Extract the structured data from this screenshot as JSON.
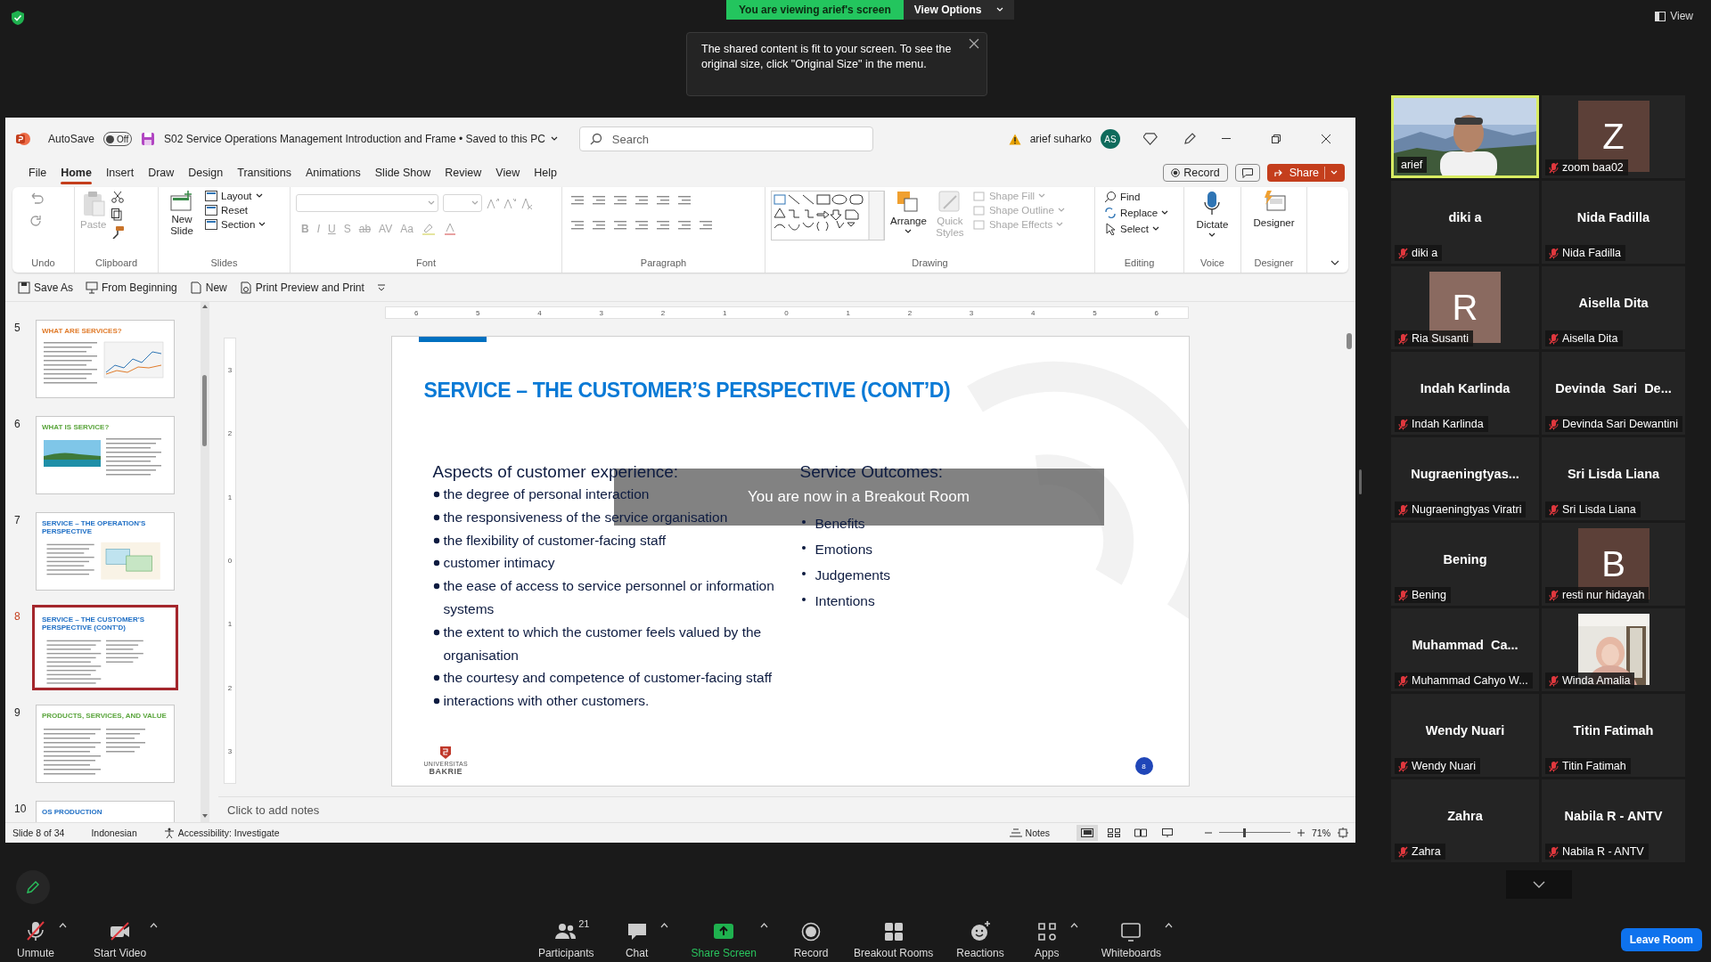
{
  "meeting": {
    "viewing_banner": "You are viewing arief's screen",
    "view_options": "View Options",
    "view_button": "View",
    "notice": "The shared content is fit to your screen. To see the original size, click \"Original Size\" in the menu.",
    "breakout_message": "You are now in a Breakout Room"
  },
  "powerpoint": {
    "autosave": {
      "label": "AutoSave",
      "state": "Off",
      "on": false
    },
    "document_title": "S02 Service Operations Management Introduction and Frame • Saved to this PC",
    "search": {
      "placeholder": "Search"
    },
    "user": {
      "name": "arief suharko",
      "initials": "AS"
    },
    "menu_tabs": [
      {
        "label": "File",
        "selected": false
      },
      {
        "label": "Home",
        "selected": true
      },
      {
        "label": "Insert",
        "selected": false
      },
      {
        "label": "Draw",
        "selected": false
      },
      {
        "label": "Design",
        "selected": false
      },
      {
        "label": "Transitions",
        "selected": false
      },
      {
        "label": "Animations",
        "selected": false
      },
      {
        "label": "Slide Show",
        "selected": false
      },
      {
        "label": "Review",
        "selected": false
      },
      {
        "label": "View",
        "selected": false
      },
      {
        "label": "Help",
        "selected": false
      }
    ],
    "record_button": "Record",
    "share_button": "Share",
    "ribbon_groups": [
      {
        "kind": "undo",
        "label": "Undo"
      },
      {
        "kind": "clipboard",
        "label": "Clipboard",
        "paste": {
          "label": "Paste",
          "disabled": true
        }
      },
      {
        "kind": "slides",
        "label": "Slides",
        "new_slide": "New Slide",
        "items": [
          "Layout",
          "Reset",
          "Section"
        ]
      },
      {
        "kind": "font",
        "label": "Font",
        "disabled": true,
        "style_buttons": [
          "B",
          "I",
          "U",
          "S",
          "ab",
          "AV",
          "Aa"
        ]
      },
      {
        "kind": "paragraph",
        "label": "Paragraph"
      },
      {
        "kind": "drawing",
        "label": "Drawing",
        "arrange": "Arrange",
        "quick_styles": {
          "label": "Quick Styles",
          "disabled": true
        },
        "shape_items": [
          {
            "label": "Shape Fill",
            "disabled": true
          },
          {
            "label": "Shape Outline",
            "disabled": true
          },
          {
            "label": "Shape Effects",
            "disabled": true
          }
        ]
      },
      {
        "kind": "editing",
        "label": "Editing",
        "items": [
          "Find",
          "Replace",
          "Select"
        ]
      },
      {
        "kind": "voice",
        "label": "Voice",
        "button": "Dictate"
      },
      {
        "kind": "designer",
        "label": "Designer",
        "button": "Designer"
      }
    ],
    "quick_access": [
      {
        "kind": "save_as",
        "label": "Save As"
      },
      {
        "kind": "from_beginning",
        "label": "From Beginning"
      },
      {
        "kind": "new",
        "label": "New"
      },
      {
        "kind": "print",
        "label": "Print Preview and Print"
      }
    ],
    "thumbnails": [
      {
        "number": "5",
        "title": "WHAT ARE SERVICES?",
        "color": "#e07b2a",
        "kind": "text_chart",
        "selected": false
      },
      {
        "number": "6",
        "title": "WHAT IS SERVICE?",
        "color": "#5aa53c",
        "selected": false
      },
      {
        "number": "7",
        "title": "SERVICE – THE OPERATION'S PERSPECTIVE",
        "color": "#1f6fc5",
        "kind": "diagram",
        "selected": false
      },
      {
        "number": "8",
        "title": "SERVICE – THE CUSTOMER'S PERSPECTIVE (CONT'D)",
        "color": "#1f6fc5",
        "kind": "two_column",
        "selected": true
      },
      {
        "number": "9",
        "title": "PRODUCTS, SERVICES, AND VALUE",
        "color": "#5aa53c",
        "kind": "two_column",
        "selected": false
      },
      {
        "number": "10",
        "title": "OS PRODUCTION",
        "color": "#1f6fc5",
        "kind": "title_only",
        "selected": false
      }
    ],
    "ruler": {
      "horizontal": [
        "6",
        "5",
        "4",
        "3",
        "2",
        "1",
        "0",
        "1",
        "2",
        "3",
        "4",
        "5",
        "6"
      ],
      "vertical": [
        "3",
        "2",
        "1",
        "0",
        "1",
        "2",
        "3"
      ]
    },
    "slide": {
      "title": "SERVICE – THE CUSTOMER’S PERSPECTIVE (CONT’D)",
      "left_heading": "Aspects of customer experience:",
      "left_bullets": [
        "the degree of personal interaction",
        "the responsiveness of the service organisation",
        "the flexibility of customer-facing staff",
        "customer intimacy",
        "the ease of access to service personnel or information systems",
        "the extent to which the customer feels valued by the organisation",
        "the courtesy and competence of customer-facing staff",
        "interactions with other customers."
      ],
      "right_heading": "Service Outcomes:",
      "right_bullets": [
        "Benefits",
        "Emotions",
        "Judgements",
        "Intentions"
      ],
      "logo_top": "UNIVERSITAS",
      "logo_name": "BAKRIE",
      "page_number": "8"
    },
    "notes": {
      "placeholder": "Click to add notes"
    },
    "status_bar": {
      "slide": "Slide 8 of 34",
      "language": "Indonesian",
      "accessibility": "Accessibility: Investigate",
      "notes": "Notes",
      "views": [
        {
          "kind": "normal",
          "selected": true
        },
        {
          "kind": "sorter",
          "selected": false
        },
        {
          "kind": "reading",
          "selected": false
        },
        {
          "kind": "slideshow",
          "selected": false
        }
      ],
      "zoom_slider": {
        "level": 0.35
      },
      "zoom": "71%"
    }
  },
  "gallery": [
    {
      "kind": "video",
      "label": "arief",
      "muted": false,
      "speaking": true
    },
    {
      "kind": "avatar",
      "letter": "Z",
      "color": "#5c4038",
      "label": "zoom baa02",
      "muted": true,
      "speaking": false
    },
    {
      "kind": "name",
      "display": "diki a",
      "label": "diki a",
      "muted": true,
      "speaking": false
    },
    {
      "kind": "name",
      "display": "Nida Fadilla",
      "label": "Nida Fadilla",
      "muted": true,
      "speaking": false
    },
    {
      "kind": "avatar",
      "letter": "R",
      "color": "#8a6a60",
      "label": "Ria Susanti",
      "muted": true,
      "speaking": false
    },
    {
      "kind": "name",
      "display": "Aisella Dita",
      "label": "Aisella Dita",
      "muted": true,
      "speaking": false
    },
    {
      "kind": "name",
      "display": "Indah Karlinda",
      "label": "Indah Karlinda",
      "muted": true,
      "speaking": false
    },
    {
      "kind": "name",
      "display": "Devinda  Sari  De...",
      "label": "Devinda Sari Dewantini",
      "muted": true,
      "speaking": false
    },
    {
      "kind": "name",
      "display": "Nugraeningtyas...",
      "label": "Nugraeningtyas Viratri",
      "muted": true,
      "speaking": false
    },
    {
      "kind": "name",
      "display": "Sri Lisda Liana",
      "label": "Sri Lisda Liana",
      "muted": true,
      "speaking": false
    },
    {
      "kind": "name",
      "display": "Bening",
      "label": "Bening",
      "muted": true,
      "speaking": false
    },
    {
      "kind": "avatar",
      "letter": "B",
      "color": "#5c4038",
      "label": "resti nur hidayah",
      "muted": true,
      "speaking": false
    },
    {
      "kind": "name",
      "display": "Muhammad  Ca...",
      "label": "Muhammad Cahyo W...",
      "muted": true,
      "speaking": false
    },
    {
      "label": "Winda Amalia",
      "muted": true,
      "speaking": false
    },
    {
      "kind": "name",
      "display": "Wendy Nuari",
      "label": "Wendy Nuari",
      "muted": true,
      "speaking": false
    },
    {
      "kind": "name",
      "display": "Titin Fatimah",
      "label": "Titin Fatimah",
      "muted": true,
      "speaking": false
    },
    {
      "kind": "name",
      "display": "Zahra",
      "label": "Zahra",
      "muted": true,
      "speaking": false
    },
    {
      "kind": "name",
      "display": "Nabila R - ANTV",
      "label": "Nabila R - ANTV",
      "muted": true,
      "speaking": false
    }
  ],
  "toolbar": {
    "left_items": [
      {
        "kind": "mic",
        "label": "Unmute",
        "caret": true
      },
      {
        "kind": "camera",
        "label": "Start Video",
        "caret": true
      }
    ],
    "center_items": [
      {
        "kind": "participants",
        "label": "Participants",
        "count": "21",
        "caret": false
      },
      {
        "kind": "chat",
        "label": "Chat",
        "caret": true
      },
      {
        "kind": "share",
        "label": "Share Screen",
        "caret": true
      },
      {
        "kind": "record",
        "label": "Record",
        "caret": false
      },
      {
        "kind": "breakout",
        "label": "Breakout Rooms",
        "caret": false
      },
      {
        "kind": "reactions",
        "label": "Reactions",
        "caret": false
      },
      {
        "kind": "apps",
        "label": "Apps",
        "caret": true
      },
      {
        "kind": "whiteboards",
        "label": "Whiteboards",
        "caret": true
      }
    ],
    "leave": "Leave Room"
  }
}
